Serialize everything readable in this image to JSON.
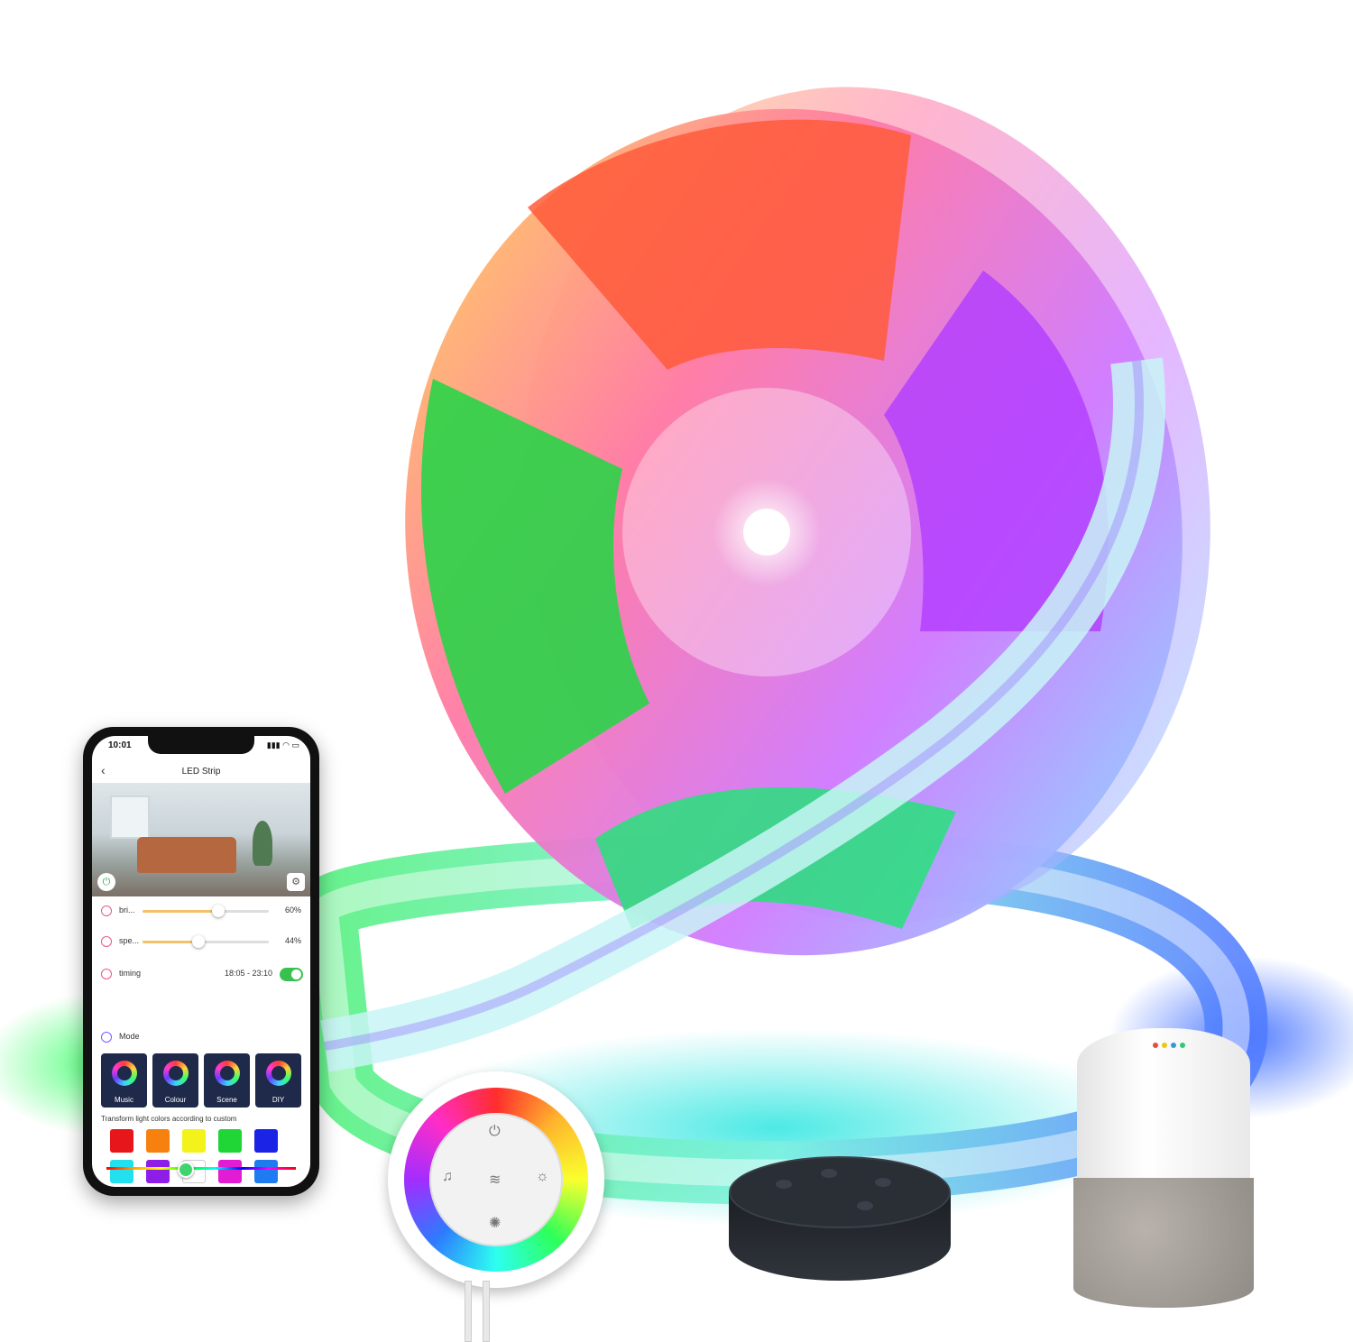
{
  "phone": {
    "status_time": "10:01",
    "status_icons": "▮▮▮ ◠ ▭",
    "app_title": "LED Strip",
    "brightness": {
      "label": "bri...",
      "percent": 60,
      "value_text": "60%"
    },
    "speed": {
      "label": "spe...",
      "percent": 44,
      "value_text": "44%"
    },
    "timing": {
      "label": "timing",
      "range": "18:05 - 23:10",
      "enabled": true
    },
    "mode_heading": "Mode",
    "modes": [
      {
        "label": "Music",
        "icon": "music-note-icon"
      },
      {
        "label": "Colour",
        "icon": "color-wheel-icon"
      },
      {
        "label": "Scene",
        "icon": "star-icon"
      },
      {
        "label": "DIY",
        "icon": "diy-icon"
      }
    ],
    "transform_text": "Transform light colors according to custom",
    "swatches": [
      "#e6161b",
      "#f7800f",
      "#f3f21a",
      "#1fd636",
      "#1a23e6",
      "#22e0ee",
      "#8f1de8",
      "#ffffff",
      "#e21cd2",
      "#1f7cf0"
    ],
    "hue_fraction": 0.42
  },
  "colors": {
    "red": "#ff3434",
    "yellow": "#ffd23a",
    "green": "#2bd84a",
    "cyan": "#2adfe8",
    "purple": "#9a3cff",
    "pink": "#ff4fc8",
    "blue": "#2f5bff"
  }
}
